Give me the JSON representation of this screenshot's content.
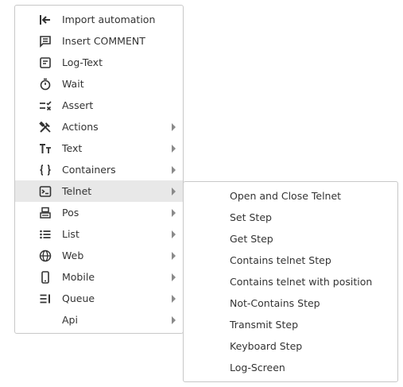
{
  "menu": {
    "items": [
      {
        "label": "Import automation",
        "icon": "import-icon",
        "submenu": false
      },
      {
        "label": "Insert COMMENT",
        "icon": "comment-icon",
        "submenu": false
      },
      {
        "label": "Log-Text",
        "icon": "log-text-icon",
        "submenu": false
      },
      {
        "label": "Wait",
        "icon": "timer-icon",
        "submenu": false
      },
      {
        "label": "Assert",
        "icon": "assert-icon",
        "submenu": false
      },
      {
        "label": "Actions",
        "icon": "tools-icon",
        "submenu": true
      },
      {
        "label": "Text",
        "icon": "text-size-icon",
        "submenu": true
      },
      {
        "label": "Containers",
        "icon": "braces-icon",
        "submenu": true
      },
      {
        "label": "Telnet",
        "icon": "terminal-icon",
        "submenu": true,
        "active": true
      },
      {
        "label": "Pos",
        "icon": "pos-icon",
        "submenu": true
      },
      {
        "label": "List",
        "icon": "list-icon",
        "submenu": true
      },
      {
        "label": "Web",
        "icon": "globe-icon",
        "submenu": true
      },
      {
        "label": "Mobile",
        "icon": "mobile-icon",
        "submenu": true
      },
      {
        "label": "Queue",
        "icon": "queue-icon",
        "submenu": true
      },
      {
        "label": "Api",
        "icon": "",
        "submenu": true
      }
    ]
  },
  "submenu": {
    "items": [
      "Open and Close Telnet",
      "Set Step",
      "Get Step",
      "Contains telnet Step",
      "Contains telnet with position",
      "Not-Contains Step",
      "Transmit Step",
      "Keyboard Step",
      "Log-Screen"
    ]
  },
  "colors": {
    "text": "#333333",
    "active_bg": "#e8e8e8",
    "border": "#c8c8c8",
    "chevron": "#8a8a8a"
  }
}
